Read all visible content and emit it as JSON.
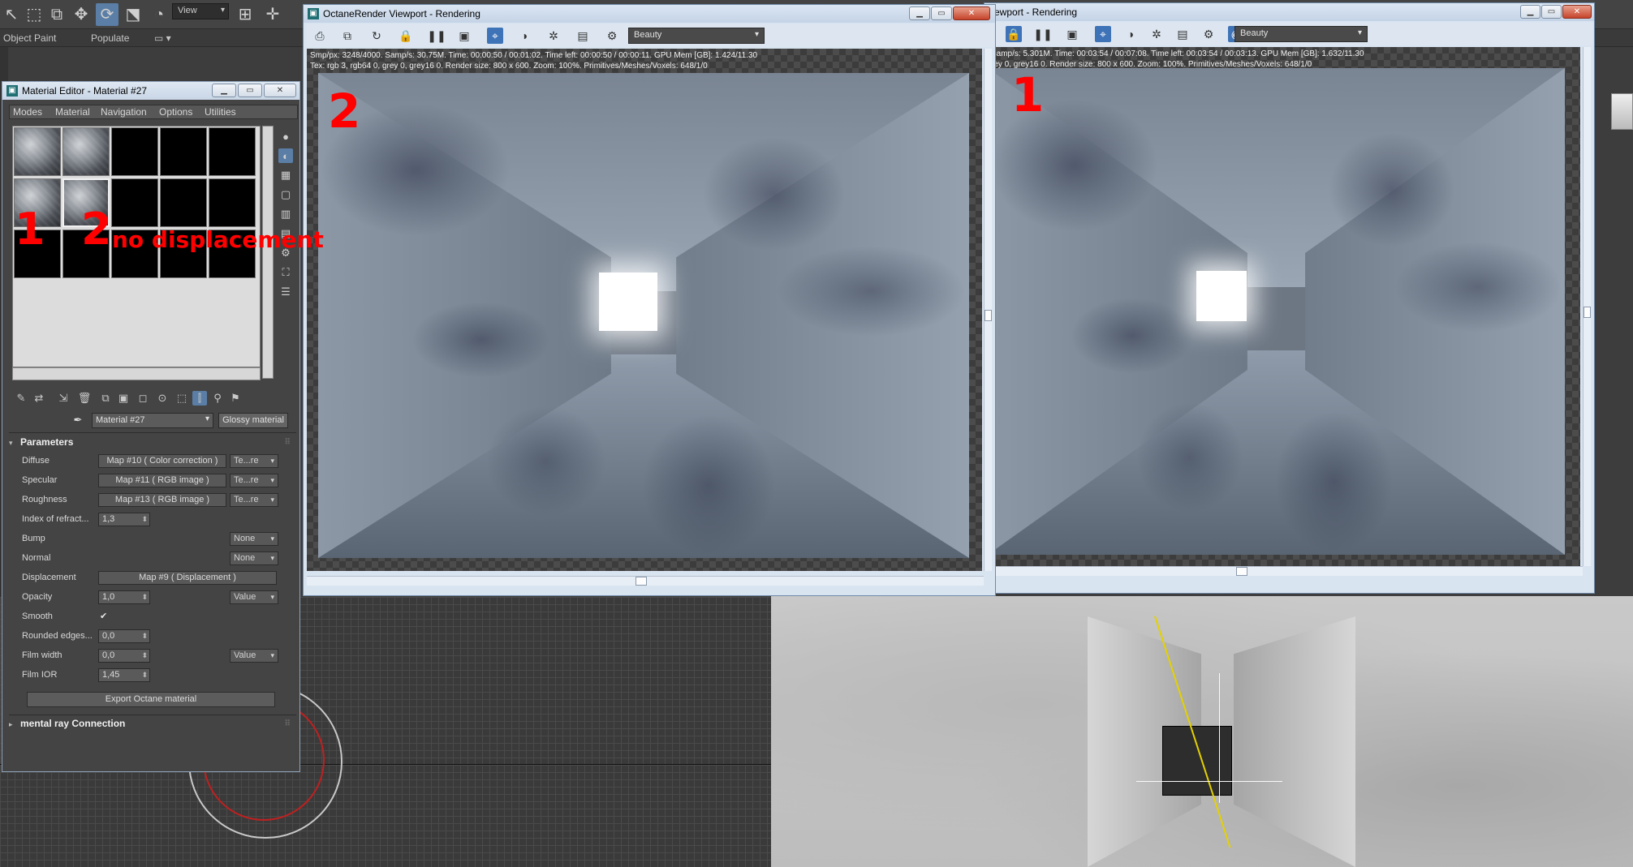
{
  "toolbar": {
    "view_dropdown": "View",
    "ribbon_tabs": [
      "Object Paint",
      "Populate"
    ]
  },
  "material_editor": {
    "title": "Material Editor - Material #27",
    "menus": [
      "Modes",
      "Material",
      "Navigation",
      "Options",
      "Utilities"
    ],
    "material_name": "Material #27",
    "material_type": "Glossy material",
    "parameters_header": "Parameters",
    "params": [
      {
        "label": "Diffuse",
        "map": "Map #10  ( Color correction )",
        "dd": "Te...re"
      },
      {
        "label": "Specular",
        "map": "Map #11  ( RGB image )",
        "dd": "Te...re"
      },
      {
        "label": "Roughness",
        "map": "Map #13  ( RGB image )",
        "dd": "Te...re"
      },
      {
        "label": "Index of refract...",
        "value": "1,3"
      },
      {
        "label": "Bump",
        "dd": "None"
      },
      {
        "label": "Normal",
        "dd": "None"
      },
      {
        "label": "Displacement",
        "map": "Map #9  ( Displacement )"
      },
      {
        "label": "Opacity",
        "value": "1,0",
        "dd": "Value"
      },
      {
        "label": "Smooth",
        "check": "✔"
      },
      {
        "label": "Rounded edges...",
        "value": "0,0"
      },
      {
        "label": "Film width",
        "value": "0,0",
        "dd": "Value"
      },
      {
        "label": "Film IOR",
        "value": "1,45"
      }
    ],
    "export_button": "Export Octane material",
    "mental_ray_header": "mental ray Connection"
  },
  "render_left": {
    "title": "OctaneRender Viewport - Rendering",
    "pass_dropdown": "Beauty",
    "stats_line1": "Smp/px: 3248/4000.   Samp/s: 30.75M.   Time: 00:00:50 / 00:01:02.   Time left: 00:00:50 / 00:00:11.   GPU Mem [GB]: 1.424/11.30",
    "stats_line2": "Tex: rgb 3, rgb64 0, grey 0, grey16 0.   Render size: 800 x 600.   Zoom: 100%.   Primitives/Meshes/Voxels: 648/1/0"
  },
  "render_right": {
    "title": "ewport - Rendering",
    "pass_dropdown": "Beauty",
    "stats_line1": "Samp/s: 5.301M.   Time: 00:03:54 / 00:07:08.   Time left: 00:03:54 / 00:03:13.   GPU Mem [GB]: 1.632/11.30",
    "stats_line2": "rey 0, grey16 0.   Render size: 800 x 600.   Zoom: 100%.   Primitives/Meshes/Voxels: 648/1/0"
  },
  "annotations": {
    "label_2_render": "2",
    "label_1_render": "1",
    "label_1_slot": "1",
    "label_2_slot": "2",
    "no_displacement": "no displacement"
  },
  "colors": {
    "annotation_red": "#ff0000",
    "active_blue": "#3e73b7"
  }
}
